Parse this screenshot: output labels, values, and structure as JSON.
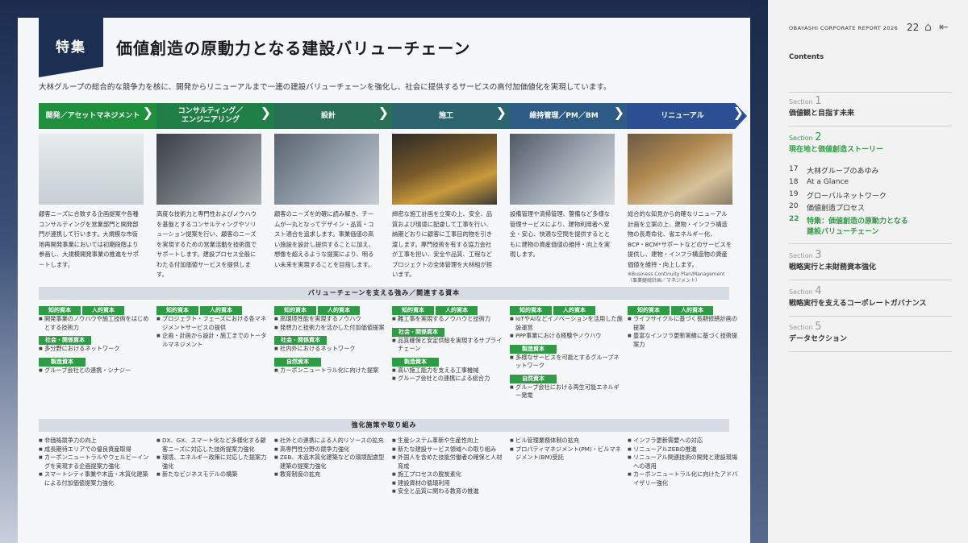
{
  "page": {
    "tag": "特集",
    "title": "価値創造の原動力となる建設バリューチェーン",
    "lead": "大林グループの総合的な競争力を核に、開発からリニューアルまで一連の建設バリューチェーンを強化し、社会に提供するサービスの高付加価値化を実現しています。"
  },
  "chain": [
    {
      "label": "開発／アセットマネジメント",
      "color": "#1f8f3e"
    },
    {
      "label": "コンサルティング／\nエンジニアリング",
      "color": "#1f7f47"
    },
    {
      "label": "設計",
      "color": "#2a6f57"
    },
    {
      "label": "施工",
      "color": "#2c6470"
    },
    {
      "label": "維持管理／PM／BM",
      "color": "#2d5b85"
    },
    {
      "label": "リニューアル",
      "color": "#2c4f94"
    }
  ],
  "columns": [
    {
      "text": "顧客ニーズに合致する企画提案や各種コンサルティングを営業部門と開発部門が連携して行います。大規模な市街地再開発事業においては初期段階より参画し、大規模開発事業の推進をサポートします。",
      "note": ""
    },
    {
      "text": "高度な技術力と専門性およびノウハウを基盤とするコンサルティングやソリューション提案を行い、顧客のニーズを実現するための営業活動を技術面でサポートします。建設プロセス全般にわたる付加価値サービスを提供します。",
      "note": ""
    },
    {
      "text": "顧客のニーズを的確に読み解き、チームが一丸となってデザイン・品質・コスト適合を追求します。事業価値の高い施設を設計し提供することに加え、想像を超えるような提案により、明るい未来を実現することを目指します。",
      "note": ""
    },
    {
      "text": "綿密な施工計画を立案の上、安全、品質および環境に配慮して工事を行い、納期どおりに顧客に工事目的物を引き渡します。専門技術を有する協力会社が工事を担い、安全や品質、工程などプロジェクトの全体管理を大林組が担います。",
      "note": ""
    },
    {
      "text": "設備管理や清掃管理、警備など多様な管理サービスにより、建物利用者へ安全・安心、快適な空間を提供するとともに建物の資産価値の維持・向上を実現します。",
      "note": ""
    },
    {
      "text": "総合的な知見から的確なリニューアル計画を立案の上、建物・インフラ構造物の長寿命化、省エネルギー化、BCP・BCM*サポートなどのサービスを提供し、建物・インフラ構造物の資産価値を維持・向上します。",
      "note": "※Business Continuity Plan/Management\n（事業継続計画／マネジメント）"
    }
  ],
  "band1": "バリューチェーンを支える強み／関連する資本",
  "band2": "強化施策や取り組み",
  "capital_labels": {
    "chiteki": "知的資本",
    "jinteki": "人的資本",
    "shakai": "社会・関係資本",
    "seizo": "製造資本",
    "shizen": "自然資本"
  },
  "strengths": [
    {
      "intellectual": [
        "開発事業のノウハウや施工技術をはじめとする技術力"
      ],
      "social": [
        "多分野におけるネットワーク"
      ],
      "manufactured": [
        "グループ会社との連携・シナジー"
      ]
    },
    {
      "intellectual": [
        "プロジェクト・フェーズにおける各マネジメントサービスの提供",
        "企画・計画から設計・施工までのトータルマネジメント"
      ]
    },
    {
      "intellectual": [
        "高環境性能を実現するノウハウ",
        "発想力と技術力を活かした付加価値提案"
      ],
      "social": [
        "社内外におけるネットワーク"
      ],
      "natural": [
        "カーボンニュートラル化に向けた提案"
      ]
    },
    {
      "intellectual": [
        "難工事を実現するノウハウと技術力"
      ],
      "social": [
        "品質確保と安定供給を実現するサプライチェーン"
      ],
      "manufactured": [
        "高い施工能力を支える工事機械",
        "グループ会社との連携による総合力"
      ]
    },
    {
      "intellectual": [
        "IoTやAIなどイノベーションを活用した施設運営",
        "PPP事業における経験やノウハウ"
      ],
      "manufactured": [
        "多様なサービスを可能とするグループネットワーク"
      ],
      "natural": [
        "グループ会社における再生可能エネルギー発電"
      ]
    },
    {
      "intellectual": [
        "ライフサイクルに基づく長期修繕計画の提案",
        "豊富なインフラ更新実績に基づく技術提案力"
      ]
    }
  ],
  "initiatives": [
    [
      "非価格競争力の向上",
      "成長期待エリアでの優良資産取得",
      "カーボンニュートラルやウェルビーイングを実現する企画提案力強化",
      "スマートシティ事業や木造・木質化建築による付加価値提案力強化"
    ],
    [
      "DX、GX、スマート化など多様化する顧客ニーズに対応した技術提案力強化",
      "環境、エネルギー政策に対応した提案力強化",
      "新たなビジネスモデルの構築"
    ],
    [
      "社外との連携による人的リソースの拡充",
      "高専門性分野の競争力強化",
      "ZEB、木造木質化建築などの環境配慮型建築の提案力強化",
      "教育制度の拡充"
    ],
    [
      "生産システム革新や生産性向上",
      "新たな建設サービス領域への取り組み",
      "外国人を含めた技能労働者の確保と人材育成",
      "施工プロセスの脱炭素化",
      "建設資材の循環利用",
      "安全と品質に関わる教育の推進"
    ],
    [
      "ビル管理業務体制の拡充",
      "プロパティマネジメント(PM)・ビルマネジメント(BM)受託"
    ],
    [
      "インフラ更新需要への対応",
      "リニューアルZEBの推進",
      "リニューアル関連技術の開発と建設現場への適用",
      "カーボンニュートラル化に向けたアドバイザリー強化"
    ]
  ],
  "sidebar": {
    "corp": "OBAYASHI CORPORATE REPORT 2026",
    "page_number": "22",
    "contents": "Contents",
    "section_word": "Section",
    "sections": [
      {
        "num": "1",
        "name": "価値観と目指す未来"
      },
      {
        "num": "2",
        "name": "現在地と価値創造ストーリー"
      },
      {
        "num": "3",
        "name": "戦略実行と未財務資本強化"
      },
      {
        "num": "4",
        "name": "戦略実行を支えるコーポレートガバナンス"
      },
      {
        "num": "5",
        "name": "データセクション"
      }
    ],
    "subitems": [
      {
        "num": "17",
        "name": "大林グループのあゆみ"
      },
      {
        "num": "18",
        "name": "At a Glance"
      },
      {
        "num": "19",
        "name": "グローバルネットワーク"
      },
      {
        "num": "20",
        "name": "価値創造プロセス"
      },
      {
        "num": "22",
        "name": "特集：価値創造の原動力となる\n建設バリューチェーン"
      }
    ]
  },
  "colors": {
    "green": "#2e9b45",
    "navy": "#1c2e52"
  }
}
